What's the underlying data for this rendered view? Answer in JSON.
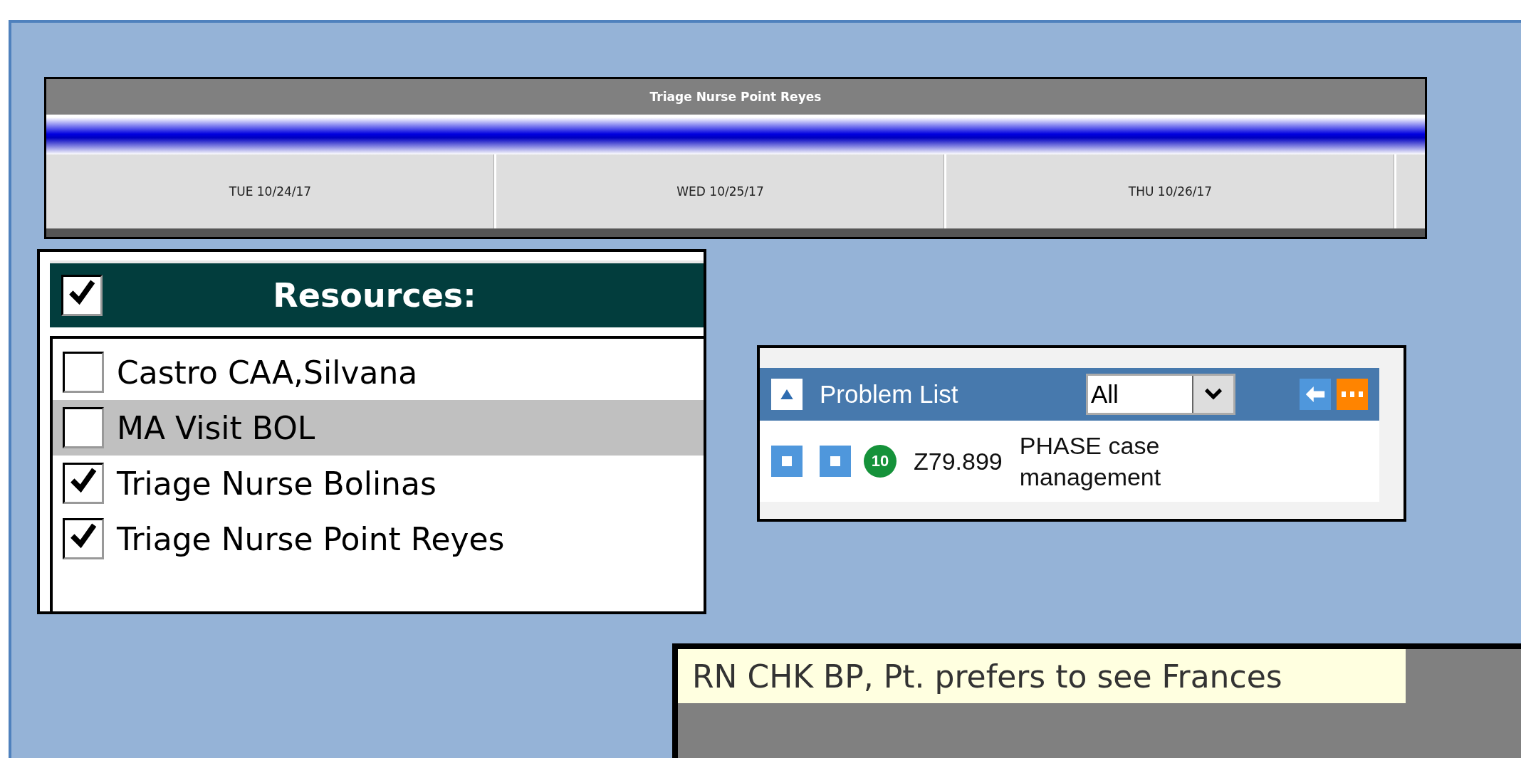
{
  "schedule": {
    "title": "Triage Nurse Point Reyes",
    "days": [
      "TUE 10/24/17",
      "WED 10/25/17",
      "THU 10/26/17"
    ]
  },
  "resources": {
    "title": "Resources:",
    "all_checked": true,
    "items": [
      {
        "label": "Castro CAA,Silvana",
        "checked": false,
        "selected": false
      },
      {
        "label": "MA Visit BOL",
        "checked": false,
        "selected": true
      },
      {
        "label": "Triage Nurse Bolinas",
        "checked": true,
        "selected": false
      },
      {
        "label": "Triage Nurse Point Reyes",
        "checked": true,
        "selected": false
      }
    ]
  },
  "problem_list": {
    "title": "Problem List",
    "filter": "All",
    "rows": [
      {
        "badge": "10",
        "code": "Z79.899",
        "description": "PHASE case management"
      }
    ]
  },
  "tooltip": {
    "text": "RN CHK BP, Pt. prefers to see Frances"
  }
}
